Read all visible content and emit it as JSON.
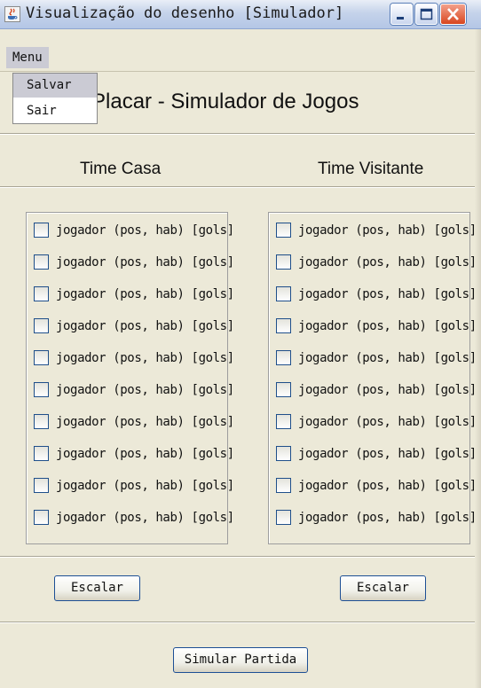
{
  "window": {
    "title": "Visualização do desenho [Simulador]",
    "controls": {
      "minimize": "minimize",
      "maximize": "maximize",
      "close": "close"
    }
  },
  "menu": {
    "label": "Menu",
    "items": [
      "Salvar",
      "Sair"
    ],
    "highlighted": "Salvar"
  },
  "header": {
    "title": "Placar - Simulador de Jogos"
  },
  "teams": {
    "home": {
      "label": "Time Casa",
      "players": [
        "jogador (pos, hab) [gols]",
        "jogador (pos, hab) [gols]",
        "jogador (pos, hab) [gols]",
        "jogador (pos, hab) [gols]",
        "jogador (pos, hab) [gols]",
        "jogador (pos, hab) [gols]",
        "jogador (pos, hab) [gols]",
        "jogador (pos, hab) [gols]",
        "jogador (pos, hab) [gols]",
        "jogador (pos, hab) [gols]"
      ],
      "button": "Escalar"
    },
    "away": {
      "label": "Time Visitante",
      "players": [
        "jogador (pos, hab) [gols]",
        "jogador (pos, hab) [gols]",
        "jogador (pos, hab) [gols]",
        "jogador (pos, hab) [gols]",
        "jogador (pos, hab) [gols]",
        "jogador (pos, hab) [gols]",
        "jogador (pos, hab) [gols]",
        "jogador (pos, hab) [gols]",
        "jogador (pos, hab) [gols]",
        "jogador (pos, hab) [gols]"
      ],
      "button": "Escalar"
    }
  },
  "footer": {
    "simulate_button": "Simular Partida"
  },
  "icons": {
    "app": "java-cup-icon"
  },
  "colors": {
    "background": "#ece9d8",
    "menu_highlight": "#cbcbd4",
    "button_border": "#1d4f95",
    "checkbox_border": "#1f4f8a",
    "close_button": "#d8461f"
  }
}
